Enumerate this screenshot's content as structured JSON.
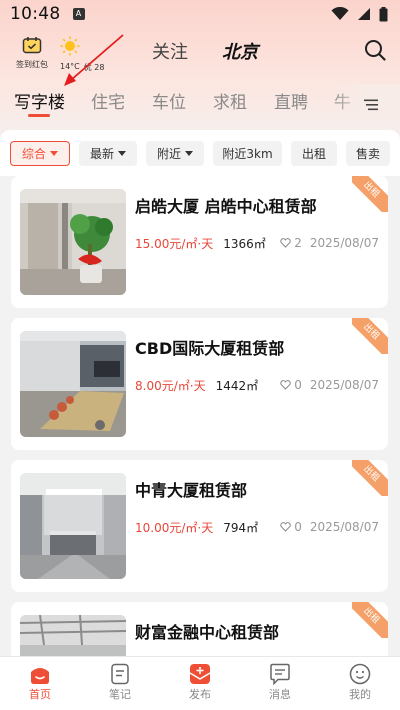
{
  "status_bar": {
    "time": "10:48",
    "app_badge": "A"
  },
  "header": {
    "checkin_label": "签到红包",
    "weather_temp": "14°C",
    "weather_aqi": "优 28",
    "tab_follow": "关注",
    "tab_city": "北京"
  },
  "categories": [
    "写字楼",
    "住宅",
    "车位",
    "求租",
    "直聘",
    "牛"
  ],
  "filters": [
    "综合",
    "最新",
    "附近",
    "附近3km",
    "出租",
    "售卖"
  ],
  "listings": [
    {
      "title": "启皓大厦 启皓中心租赁部",
      "price": "15.00元/㎡·天",
      "area": "1366㎡",
      "likes": "2",
      "date": "2025/08/07",
      "tag": "出租"
    },
    {
      "title": "CBD国际大厦租赁部",
      "price": "8.00元/㎡·天",
      "area": "1442㎡",
      "likes": "0",
      "date": "2025/08/07",
      "tag": "出租"
    },
    {
      "title": "中青大厦租赁部",
      "price": "10.00元/㎡·天",
      "area": "794㎡",
      "likes": "0",
      "date": "2025/08/07",
      "tag": "出租"
    },
    {
      "title": "财富金融中心租赁部",
      "price": "",
      "area": "",
      "likes": "",
      "date": "",
      "tag": "出租"
    }
  ],
  "bottom_nav": [
    {
      "label": "首页",
      "icon": "home-icon",
      "active": true
    },
    {
      "label": "笔记",
      "icon": "note-icon",
      "active": false
    },
    {
      "label": "发布",
      "icon": "publish-icon",
      "active": false
    },
    {
      "label": "消息",
      "icon": "message-icon",
      "active": false
    },
    {
      "label": "我的",
      "icon": "profile-icon",
      "active": false
    }
  ],
  "colors": {
    "accent": "#ee4d36",
    "price": "#e8473a",
    "ribbon": "#f5a068",
    "header_gradient_top": "#fbd4cc"
  }
}
